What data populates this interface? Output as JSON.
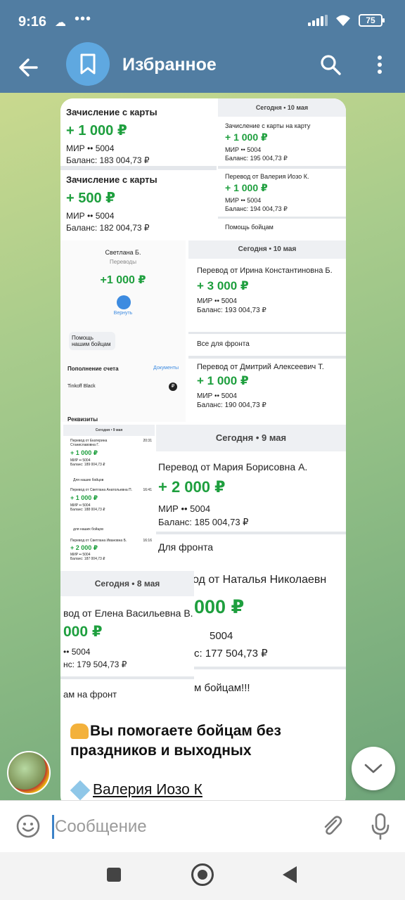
{
  "status": {
    "time": "9:16",
    "battery": "75"
  },
  "header": {
    "title": "Избранное"
  },
  "collage": {
    "c1": {
      "items": [
        {
          "title": "Зачисление с карты",
          "amount": "+ 1 000 ₽",
          "card": "МИР •• 5004",
          "balance": "Баланс: 183 004,73 ₽"
        },
        {
          "title": "Зачисление с карты",
          "amount": "+ 500 ₽",
          "card": "МИР •• 5004",
          "balance": "Баланс: 182 004,73 ₽"
        }
      ]
    },
    "c2": {
      "date": "Сегодня • 10 мая",
      "items": [
        {
          "title": "Зачисление с карты на карту",
          "amount": "+ 1 000 ₽",
          "card": "МИР •• 5004",
          "balance": "Баланс: 195 004,73 ₽"
        },
        {
          "title": "Перевод от Валерия Иозо К.",
          "amount": "+ 1 000 ₽",
          "card": "МИР •• 5004",
          "balance": "Баланс: 194 004,73 ₽"
        }
      ],
      "note": "Помощь бойцам"
    },
    "c3": {
      "name": "Светлана Б.",
      "type": "Переводы",
      "amount": "+1 000 ₽",
      "return_label": "Вернуть",
      "message": "Помощь нашим бойцам",
      "section": "Пополнение счета",
      "docs": "Документы",
      "bank": "Tinkoff Black",
      "requisites": "Реквизиты"
    },
    "c4": {
      "date": "Сегодня • 10 мая",
      "items": [
        {
          "title": "Перевод от Ирина Константиновна Б.",
          "amount": "+ 3 000 ₽",
          "card": "МИР •• 5004",
          "balance": "Баланс: 193 004,73 ₽",
          "note": "Все для фронта"
        },
        {
          "title": "Перевод от Дмитрий Алексеевич Т.",
          "amount": "+ 1 000 ₽",
          "card": "МИР •• 5004",
          "balance": "Баланс: 190 004,73 ₽"
        }
      ]
    },
    "c5": {
      "date": "Сегодня • 9 мая",
      "items": [
        {
          "title": "Перевод от Екатерина Станиславовна Г.",
          "time": "20:31",
          "amount": "+ 1 000 ₽",
          "card": "МИР •• 5004",
          "balance": "Баланс: 189 004,73 ₽",
          "note": "Для наших бойцов"
        },
        {
          "title": "Перевод от Светлана Анатольевна П.",
          "time": "16:41",
          "amount": "+ 1 000 ₽",
          "card": "МИР •• 5004",
          "balance": "Баланс: 188 004,73 ₽",
          "note": "для наших бойцов"
        },
        {
          "title": "Перевод от Светлана Ивановна Б.",
          "time": "16:16",
          "amount": "+ 2 000 ₽",
          "card": "МИР •• 5004",
          "balance": "Баланс: 187 004,73 ₽"
        }
      ]
    },
    "c6": {
      "date": "Сегодня • 9 мая",
      "title": "Перевод от Мария Борисовна А.",
      "amount": "+ 2 000 ₽",
      "card": "МИР •• 5004",
      "balance": "Баланс: 185 004,73 ₽",
      "note": "Для фронта"
    },
    "c7": {
      "title": "од от Наталья Николаевн",
      "amount": "000 ₽",
      "card": "5004",
      "balance": "с: 177 504,73 ₽",
      "note": "м бойцам!!!"
    },
    "c8": {
      "date": "Сегодня • 8 мая",
      "title": "вод от Елена Васильевна В.",
      "amount": "000 ₽",
      "card": "•• 5004",
      "balance": "нс: 179 504,73 ₽",
      "note": "ам на фронт"
    }
  },
  "caption": {
    "text": "Вы помогаете бойцам без праздников и выходных",
    "link": "Валерия Иозо К"
  },
  "input": {
    "placeholder": "Сообщение"
  }
}
